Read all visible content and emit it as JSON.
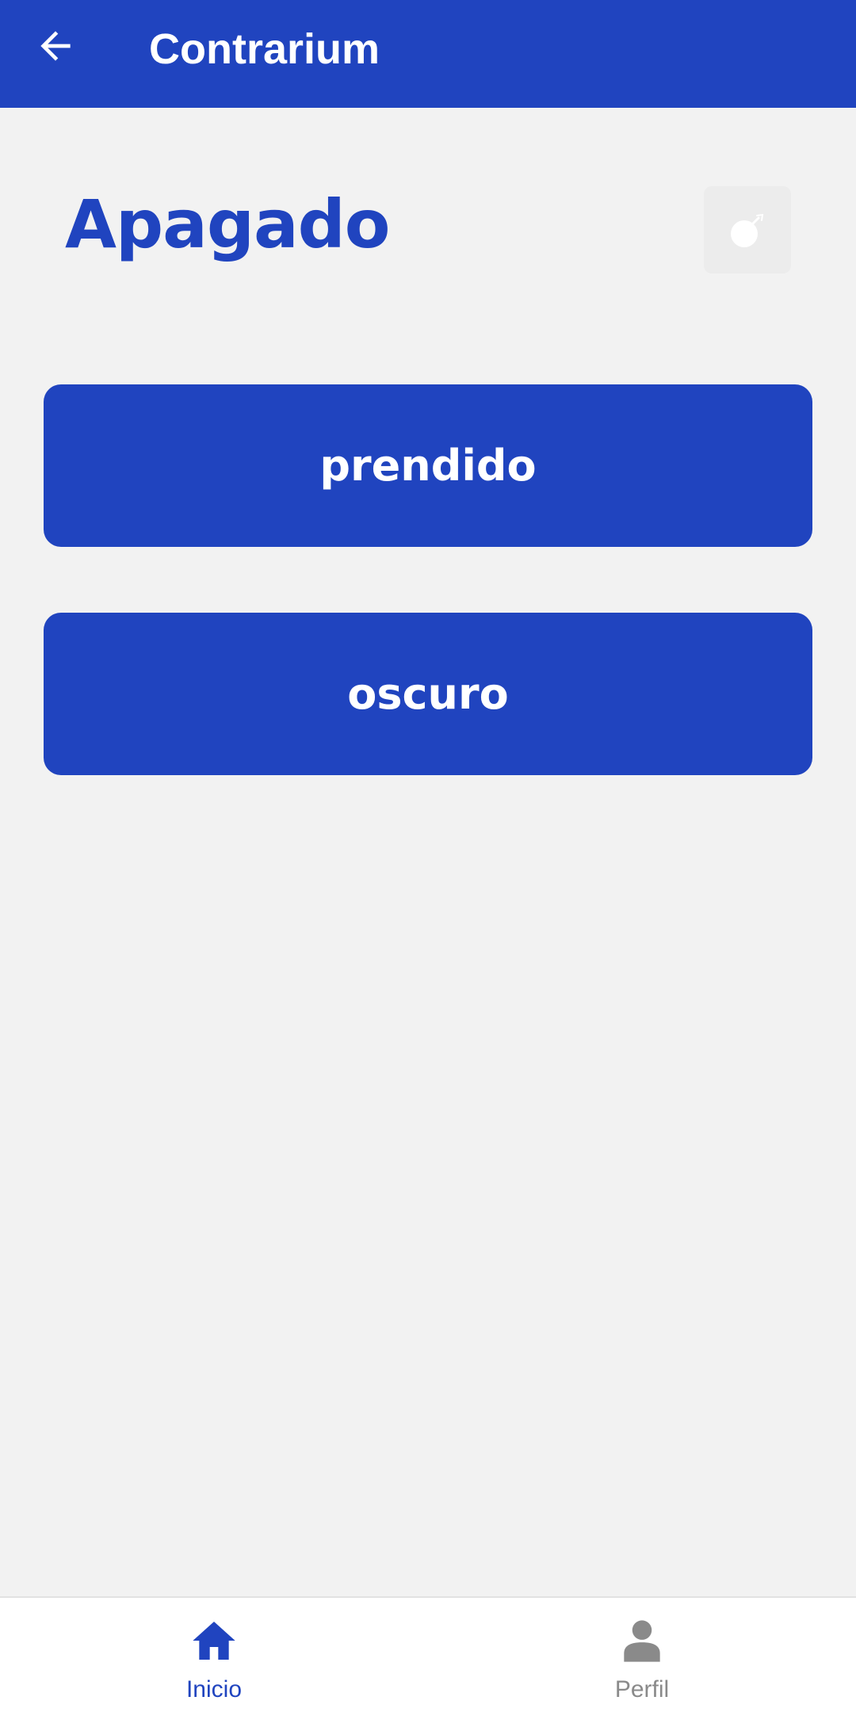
{
  "app_bar": {
    "title": "Contrarium",
    "back_icon": "arrow-left-icon"
  },
  "question": {
    "word": "Apagado",
    "hint_icon": "bomb-icon"
  },
  "options": [
    {
      "label": "prendido"
    },
    {
      "label": "oscuro"
    }
  ],
  "bottom_nav": {
    "items": [
      {
        "label": "Inicio",
        "icon": "home-icon",
        "active": true
      },
      {
        "label": "Perfil",
        "icon": "person-icon",
        "active": false
      }
    ]
  },
  "colors": {
    "primary": "#2044bf",
    "background": "#f2f2f2",
    "nav_inactive": "#8a8a8a"
  }
}
